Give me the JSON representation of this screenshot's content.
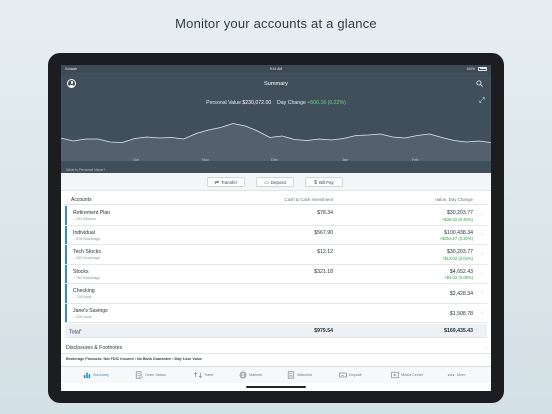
{
  "headline": "Monitor your accounts at a glance",
  "status_bar": {
    "carrier": "Schwab",
    "time": "9:41 AM",
    "battery": "100%"
  },
  "header": {
    "title": "Summary"
  },
  "summary": {
    "value_label": "Personal Value",
    "value": "$230,072.00",
    "change_label": "Day Change",
    "change": "+506.16 (0.22%)"
  },
  "chart_data": {
    "type": "area",
    "title": "",
    "xlabel": "",
    "ylabel": "",
    "x_ticks": [
      "Oct",
      "Nov",
      "Dec",
      "Jan",
      "Feb"
    ],
    "values": [
      46,
      40,
      44,
      44,
      38,
      37,
      45,
      48,
      46,
      47,
      44,
      55,
      62,
      67,
      75,
      70,
      60,
      47,
      50,
      43,
      41,
      44,
      42,
      45,
      51,
      52,
      54,
      48,
      46,
      51,
      54,
      47,
      41,
      38,
      40,
      37
    ],
    "ylim": [
      0,
      100
    ],
    "grid": false,
    "legend": "none"
  },
  "what_is_link": "What is Personal Value?",
  "actions": [
    {
      "label": "Transfer",
      "icon": "transfer-icon"
    },
    {
      "label": "Deposit",
      "icon": "deposit-icon"
    },
    {
      "label": "Bill Pay",
      "icon": "bill-pay-icon"
    }
  ],
  "table": {
    "col_accounts": "Accounts",
    "col_cash": "Cash & Cash Investment",
    "col_value": "Value, Day Change",
    "rows": [
      {
        "name": "Retirement Plan",
        "sub": "...232 Alliance",
        "cash": "$78.34",
        "value": "$30,203.77",
        "change": "+$36.02 (0.40%)"
      },
      {
        "name": "Individual",
        "sub": "...876 Brokerage",
        "cash": "$567.90",
        "value": "$100,438.34",
        "change": "+$251.17 (0.20%)"
      },
      {
        "name": "Tech Stocks",
        "sub": "...342 Brokerage",
        "cash": "$12.12",
        "value": "$30,203.77",
        "change": "+$13.02 (0.04%)"
      },
      {
        "name": "Stocks",
        "sub": "...784 Brokerage",
        "cash": "$321.18",
        "value": "$4,652.43",
        "change": "+$4.02 (0.08%)"
      },
      {
        "name": "Checking",
        "sub": "...718 Bank",
        "cash": "",
        "value": "$2,428.34",
        "change": ""
      },
      {
        "name": "Jane's Savings",
        "sub": "...438 Bank",
        "cash": "",
        "value": "$1,508.78",
        "change": ""
      }
    ],
    "total_label": "Total",
    "total_cash": "$979.54",
    "total_value": "$169,435.43"
  },
  "disclosures": "Disclosures & Footnotes",
  "brokerage_note": "Brokerage Products: Not FDIC Insured • No Bank Guarantee • May Lose Value",
  "tabs": [
    {
      "label": "Summary",
      "icon": "bar-chart-icon",
      "active": true
    },
    {
      "label": "Order Status",
      "icon": "order-status-icon",
      "active": false
    },
    {
      "label": "Trade",
      "icon": "trade-icon",
      "active": false
    },
    {
      "label": "Markets",
      "icon": "globe-icon",
      "active": false
    },
    {
      "label": "Watchlist",
      "icon": "watchlist-icon",
      "active": false
    },
    {
      "label": "Deposit",
      "icon": "deposit-icon",
      "active": false
    },
    {
      "label": "Media Center",
      "icon": "play-icon",
      "active": false
    },
    {
      "label": "More",
      "icon": "more-icon",
      "active": false
    }
  ],
  "colors": {
    "header_bg": "#414f5b",
    "accent": "#2c8bd4",
    "positive": "#2e9e48"
  }
}
